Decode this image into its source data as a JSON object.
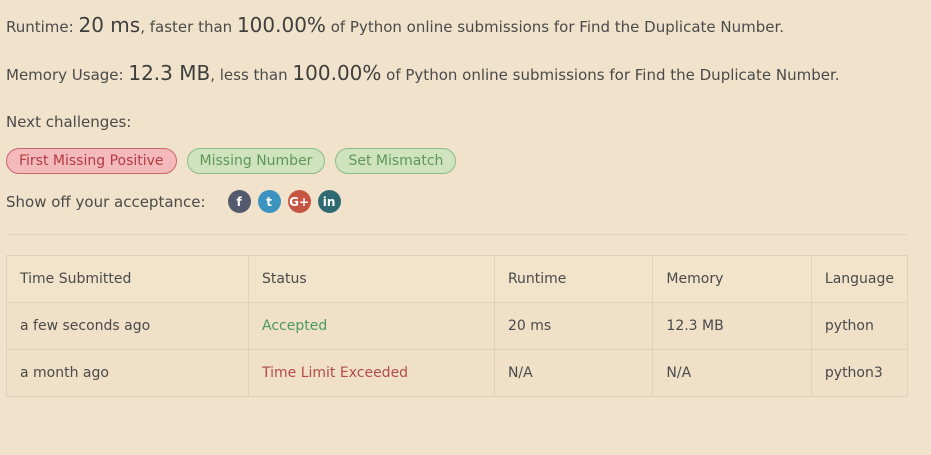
{
  "result": {
    "runtime_label": "Runtime: ",
    "runtime_value": "20 ms",
    "runtime_mid": ", faster than ",
    "runtime_pct": "100.00%",
    "runtime_tail": " of Python online submissions for Find the Duplicate Number.",
    "memory_label": "Memory Usage: ",
    "memory_value": "12.3 MB",
    "memory_mid": ", less than ",
    "memory_pct": "100.00%",
    "memory_tail": " of Python online submissions for Find the Duplicate Number."
  },
  "next": {
    "label": "Next challenges:",
    "challenges": [
      {
        "title": "First Missing Positive",
        "difficulty": "hard"
      },
      {
        "title": "Missing Number",
        "difficulty": "easy"
      },
      {
        "title": "Set Mismatch",
        "difficulty": "easy"
      }
    ]
  },
  "share": {
    "label": "Show off your acceptance:",
    "icons": [
      "facebook-icon",
      "twitter-icon",
      "google-plus-icon",
      "linkedin-icon"
    ],
    "glyphs": [
      "f",
      "t",
      "G+",
      "in"
    ]
  },
  "submissions": {
    "headers": [
      "Time Submitted",
      "Status",
      "Runtime",
      "Memory",
      "Language"
    ],
    "rows": [
      {
        "time": "a few seconds ago",
        "status": "Accepted",
        "runtime": "20 ms",
        "memory": "12.3 MB",
        "language": "python"
      },
      {
        "time": "a month ago",
        "status": "Time Limit Exceeded",
        "runtime": "N/A",
        "memory": "N/A",
        "language": "python3"
      }
    ]
  }
}
